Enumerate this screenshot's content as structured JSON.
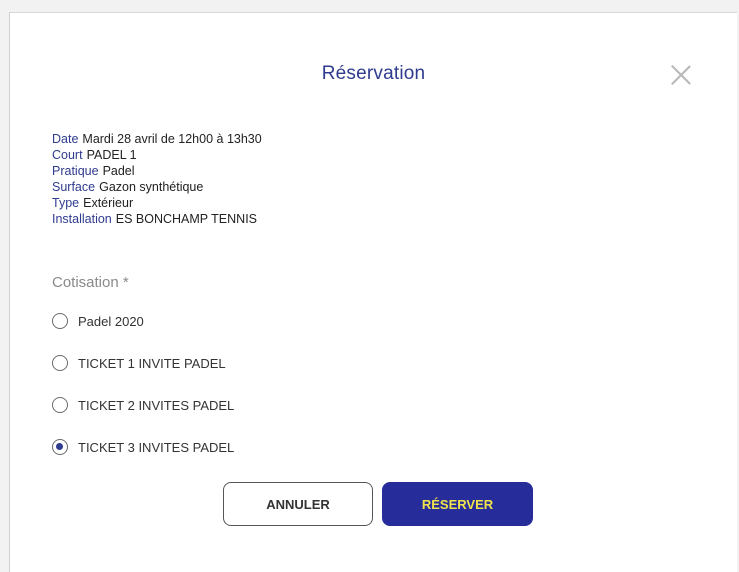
{
  "modal": {
    "title": "Réservation",
    "close_icon": "close-icon"
  },
  "details": [
    {
      "label": "Date",
      "value": "Mardi 28 avril de 12h00 à 13h30"
    },
    {
      "label": "Court",
      "value": "PADEL 1"
    },
    {
      "label": "Pratique",
      "value": "Padel"
    },
    {
      "label": "Surface",
      "value": "Gazon synthétique"
    },
    {
      "label": "Type",
      "value": "Extérieur"
    },
    {
      "label": "Installation",
      "value": "ES BONCHAMP TENNIS"
    }
  ],
  "cotisation": {
    "label": "Cotisation *",
    "options": [
      {
        "label": "Padel 2020",
        "selected": false
      },
      {
        "label": "TICKET 1 INVITE PADEL",
        "selected": false
      },
      {
        "label": "TICKET 2 INVITES PADEL",
        "selected": false
      },
      {
        "label": "TICKET 3 INVITES PADEL",
        "selected": true
      }
    ]
  },
  "buttons": {
    "cancel_label": "ANNULER",
    "reserve_label": "RÉSERVER"
  },
  "colors": {
    "accent": "#2f3b8f",
    "reserve_button_bg": "#262d9a",
    "reserve_button_text": "#f0e34a"
  }
}
